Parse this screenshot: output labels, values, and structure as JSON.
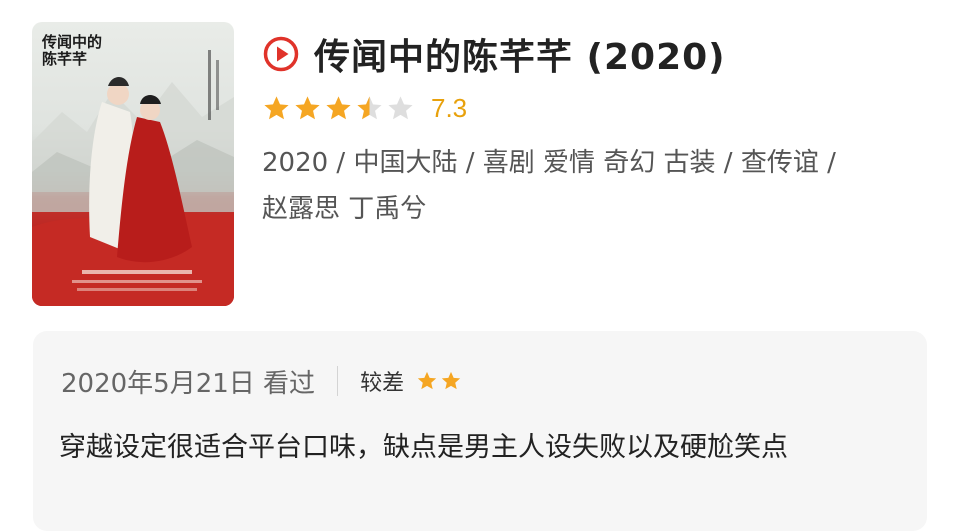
{
  "movie": {
    "title": "传闻中的陈芊芊 (2020)",
    "rating": {
      "stars": 3.5,
      "max_stars": 5,
      "score": "7.3"
    },
    "meta_line1": "2020 / 中国大陆 / 喜剧 爱情 奇幻 古装 / 查传谊 /",
    "meta_line2": "赵露思 丁禹兮",
    "poster_title": "传闻中的陈芊芊"
  },
  "review": {
    "date_status": "2020年5月21日 看过",
    "rating_label": "较差",
    "rating_stars": 2,
    "text": "穿越设定很适合平台口味，缺点是男主人设失败以及硬尬笑点"
  },
  "colors": {
    "accent_red": "#e0332a",
    "star_gold": "#f5a623",
    "star_empty": "#dedede",
    "score": "#e8a10c"
  },
  "icons": [
    "play-circle-icon",
    "star-icon"
  ]
}
